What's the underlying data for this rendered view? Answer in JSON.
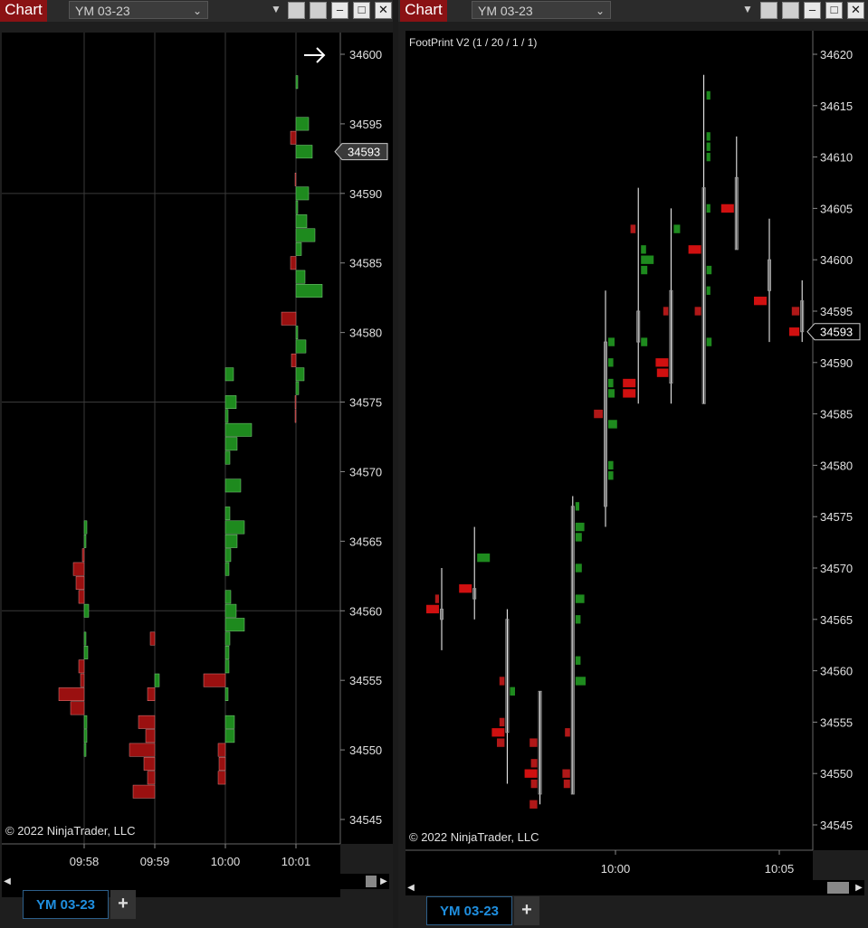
{
  "left": {
    "title_badge": "Chart",
    "symbol": "YM 03-23",
    "copyright": "© 2022 NinjaTrader, LLC",
    "tab_label": "YM 03-23",
    "add_tab": "+"
  },
  "right": {
    "title_badge": "Chart",
    "symbol": "YM 03-23",
    "indicator_label": "FootPrint V2 (1 / 20 / 1 / 1)",
    "copyright": "© 2022 NinjaTrader, LLC",
    "tab_label": "YM 03-23",
    "add_tab": "+"
  },
  "icons": {
    "dropdown": "chevron-down-icon",
    "caret": "caret-down-icon",
    "minimize": "minimize-icon",
    "maximize": "maximize-icon",
    "close": "close-icon",
    "scroll_left": "arrow-left-icon",
    "scroll_right": "arrow-right-icon",
    "right_arrow": "arrow-right-icon"
  },
  "colors": {
    "buy": "#1e8a1e",
    "sell": "#9a1010",
    "sell_bright": "#d01010",
    "background": "#000000",
    "badge": "#8a1214",
    "tab_text": "#1f8fe0"
  },
  "chart_data": [
    {
      "type": "bar",
      "subtype": "volume-profile-per-bar",
      "x_ticks": [
        "09:58",
        "09:59",
        "10:00",
        "10:01"
      ],
      "ylim": [
        34544,
        34603
      ],
      "y_ticks": [
        34545,
        34550,
        34555,
        34560,
        34565,
        34570,
        34575,
        34580,
        34585,
        34590,
        34595,
        34600
      ],
      "last_price": "34593",
      "grid": true,
      "profiles": [
        {
          "bar": "09:58",
          "levels": [
            {
              "price": 34566,
              "buy": 0.3
            },
            {
              "price": 34565,
              "buy": 0.2
            },
            {
              "price": 34564,
              "sell": 0.2
            },
            {
              "price": 34563,
              "sell": 1.2
            },
            {
              "price": 34562,
              "sell": 0.9
            },
            {
              "price": 34561,
              "sell": 0.6
            },
            {
              "price": 34560,
              "buy": 0.5
            },
            {
              "price": 34558,
              "buy": 0.2
            },
            {
              "price": 34557,
              "buy": 0.4
            },
            {
              "price": 34556,
              "sell": 0.6
            },
            {
              "price": 34555,
              "sell": 0.4
            },
            {
              "price": 34554,
              "sell": 2.8
            },
            {
              "price": 34553,
              "sell": 1.5
            },
            {
              "price": 34552,
              "buy": 0.3
            },
            {
              "price": 34551,
              "buy": 0.3
            },
            {
              "price": 34550,
              "buy": 0.2
            }
          ]
        },
        {
          "bar": "09:59",
          "levels": [
            {
              "price": 34558,
              "sell": 0.5
            },
            {
              "price": 34555,
              "buy": 0.5
            },
            {
              "price": 34554,
              "sell": 0.8
            },
            {
              "price": 34552,
              "sell": 1.8
            },
            {
              "price": 34551,
              "sell": 1.0
            },
            {
              "price": 34550,
              "sell": 2.8
            },
            {
              "price": 34549,
              "sell": 1.2
            },
            {
              "price": 34548,
              "sell": 0.8
            },
            {
              "price": 34547,
              "sell": 2.4
            }
          ]
        },
        {
          "bar": "10:00",
          "levels": [
            {
              "price": 34577,
              "buy": 0.9
            },
            {
              "price": 34575,
              "buy": 1.2
            },
            {
              "price": 34574,
              "buy": 0.3
            },
            {
              "price": 34573,
              "buy": 2.9
            },
            {
              "price": 34572,
              "buy": 1.3
            },
            {
              "price": 34571,
              "buy": 0.5
            },
            {
              "price": 34569,
              "buy": 1.7
            },
            {
              "price": 34567,
              "buy": 0.5
            },
            {
              "price": 34566,
              "buy": 2.1
            },
            {
              "price": 34565,
              "buy": 1.3
            },
            {
              "price": 34564,
              "buy": 0.6
            },
            {
              "price": 34563,
              "buy": 0.4
            },
            {
              "price": 34561,
              "buy": 0.6
            },
            {
              "price": 34560,
              "buy": 1.2
            },
            {
              "price": 34559,
              "buy": 2.1
            },
            {
              "price": 34558,
              "buy": 0.5
            },
            {
              "price": 34557,
              "buy": 0.4
            },
            {
              "price": 34556,
              "buy": 0.4
            },
            {
              "price": 34555,
              "sell": 2.4
            },
            {
              "price": 34554,
              "buy": 0.3
            },
            {
              "price": 34552,
              "buy": 1.0
            },
            {
              "price": 34551,
              "buy": 1.0
            },
            {
              "price": 34550,
              "sell": 0.8
            },
            {
              "price": 34549,
              "sell": 0.7
            },
            {
              "price": 34548,
              "sell": 0.8
            }
          ]
        },
        {
          "bar": "10:01",
          "levels": [
            {
              "price": 34598,
              "buy": 0.2
            },
            {
              "price": 34595,
              "buy": 1.4
            },
            {
              "price": 34594,
              "sell": 0.6
            },
            {
              "price": 34593,
              "buy": 1.8
            },
            {
              "price": 34591,
              "sell": 0.1
            },
            {
              "price": 34590,
              "buy": 1.4
            },
            {
              "price": 34589,
              "buy": 0.2
            },
            {
              "price": 34588,
              "buy": 1.2
            },
            {
              "price": 34587,
              "buy": 2.1
            },
            {
              "price": 34586,
              "buy": 0.6
            },
            {
              "price": 34585,
              "sell": 0.6
            },
            {
              "price": 34584,
              "buy": 1.0
            },
            {
              "price": 34583,
              "buy": 2.9
            },
            {
              "price": 34581,
              "sell": 1.6
            },
            {
              "price": 34580,
              "buy": 0.2
            },
            {
              "price": 34579,
              "buy": 1.1
            },
            {
              "price": 34578,
              "sell": 0.5
            },
            {
              "price": 34577,
              "buy": 0.9
            },
            {
              "price": 34576,
              "buy": 0.3
            },
            {
              "price": 34575,
              "sell": 0.1
            },
            {
              "price": 34574,
              "sell": 0.1
            }
          ]
        }
      ]
    },
    {
      "type": "bar",
      "subtype": "footprint",
      "title": "FootPrint V2 (1 / 20 / 1 / 1)",
      "x_ticks": [
        {
          "label": "10:00",
          "bar": 5
        },
        {
          "label": "10:05",
          "bar": 10
        }
      ],
      "ylim": [
        34543.5,
        34622
      ],
      "y_ticks": [
        34545,
        34550,
        34555,
        34560,
        34565,
        34570,
        34575,
        34580,
        34585,
        34590,
        34595,
        34600,
        34605,
        34610,
        34615,
        34620
      ],
      "last_price": "34593",
      "bars": [
        {
          "index": 0,
          "high": 34570,
          "low": 34562,
          "open": 34566,
          "close": 34565,
          "sell": [
            {
              "p": 34566,
              "v": 1.0
            },
            {
              "p": 34567,
              "v": 0.3
            }
          ],
          "buy": []
        },
        {
          "index": 1,
          "high": 34574,
          "low": 34565,
          "open": 34568,
          "close": 34567,
          "sell": [
            {
              "p": 34568,
              "v": 1.0
            }
          ],
          "buy": [
            {
              "p": 34571,
              "v": 1.0
            }
          ]
        },
        {
          "index": 2,
          "high": 34566,
          "low": 34549,
          "open": 34565,
          "close": 34554,
          "sell": [
            {
              "p": 34559,
              "v": 0.4
            },
            {
              "p": 34554,
              "v": 1.0
            },
            {
              "p": 34555,
              "v": 0.4
            },
            {
              "p": 34553,
              "v": 0.6
            }
          ],
          "buy": [
            {
              "p": 34558,
              "v": 0.4
            }
          ]
        },
        {
          "index": 3,
          "high": 34558,
          "low": 34547,
          "open": 34558,
          "close": 34548,
          "sell": [
            {
              "p": 34553,
              "v": 0.6
            },
            {
              "p": 34551,
              "v": 0.5
            },
            {
              "p": 34550,
              "v": 1.0
            },
            {
              "p": 34549,
              "v": 0.5
            },
            {
              "p": 34547,
              "v": 0.6
            }
          ],
          "buy": []
        },
        {
          "index": 4,
          "high": 34577,
          "low": 34548,
          "open": 34548,
          "close": 34576,
          "sell": [
            {
              "p": 34554,
              "v": 0.4
            },
            {
              "p": 34550,
              "v": 0.6
            },
            {
              "p": 34549,
              "v": 0.5
            }
          ],
          "buy": [
            {
              "p": 34576,
              "v": 0.3
            },
            {
              "p": 34574,
              "v": 0.7
            },
            {
              "p": 34573,
              "v": 0.5
            },
            {
              "p": 34570,
              "v": 0.5
            },
            {
              "p": 34567,
              "v": 0.7
            },
            {
              "p": 34565,
              "v": 0.4
            },
            {
              "p": 34561,
              "v": 0.4
            },
            {
              "p": 34559,
              "v": 0.8
            }
          ]
        },
        {
          "index": 5,
          "high": 34597,
          "low": 34574,
          "open": 34576,
          "close": 34592,
          "sell": [
            {
              "p": 34585,
              "v": 0.7
            }
          ],
          "buy": [
            {
              "p": 34592,
              "v": 0.5
            },
            {
              "p": 34590,
              "v": 0.4
            },
            {
              "p": 34588,
              "v": 0.4
            },
            {
              "p": 34587,
              "v": 0.5
            },
            {
              "p": 34584,
              "v": 0.7
            },
            {
              "p": 34580,
              "v": 0.4
            },
            {
              "p": 34579,
              "v": 0.4
            }
          ]
        },
        {
          "index": 6,
          "high": 34607,
          "low": 34586,
          "open": 34595,
          "close": 34592,
          "sell": [
            {
              "p": 34603,
              "v": 0.4
            },
            {
              "p": 34588,
              "v": 1.0
            },
            {
              "p": 34587,
              "v": 1.0
            }
          ],
          "buy": [
            {
              "p": 34601,
              "v": 0.4
            },
            {
              "p": 34600,
              "v": 1.0
            },
            {
              "p": 34599,
              "v": 0.5
            },
            {
              "p": 34592,
              "v": 0.5
            }
          ]
        },
        {
          "index": 7,
          "high": 34605,
          "low": 34586,
          "open": 34588,
          "close": 34597,
          "sell": [
            {
              "p": 34595,
              "v": 0.4
            },
            {
              "p": 34590,
              "v": 1.0
            },
            {
              "p": 34589,
              "v": 0.9
            }
          ],
          "buy": [
            {
              "p": 34603,
              "v": 0.5
            }
          ]
        },
        {
          "index": 8,
          "high": 34618,
          "low": 34586,
          "open": 34586,
          "close": 34607,
          "sell": [
            {
              "p": 34601,
              "v": 1.0
            },
            {
              "p": 34595,
              "v": 0.5
            }
          ],
          "buy": [
            {
              "p": 34616,
              "v": 0.3
            },
            {
              "p": 34612,
              "v": 0.3
            },
            {
              "p": 34611,
              "v": 0.3
            },
            {
              "p": 34610,
              "v": 0.3
            },
            {
              "p": 34605,
              "v": 0.3
            },
            {
              "p": 34599,
              "v": 0.4
            },
            {
              "p": 34597,
              "v": 0.3
            },
            {
              "p": 34592,
              "v": 0.4
            }
          ]
        },
        {
          "index": 9,
          "high": 34612,
          "low": 34601,
          "open": 34608,
          "close": 34601,
          "sell": [
            {
              "p": 34605,
              "v": 1.0
            }
          ],
          "buy": []
        },
        {
          "index": 10,
          "high": 34604,
          "low": 34592,
          "open": 34600,
          "close": 34597,
          "sell": [
            {
              "p": 34596,
              "v": 1.0
            }
          ],
          "buy": []
        },
        {
          "index": 11,
          "high": 34598,
          "low": 34592,
          "open": 34596,
          "close": 34593,
          "sell": [
            {
              "p": 34595,
              "v": 0.6
            },
            {
              "p": 34593,
              "v": 0.8
            }
          ],
          "buy": []
        }
      ]
    }
  ]
}
